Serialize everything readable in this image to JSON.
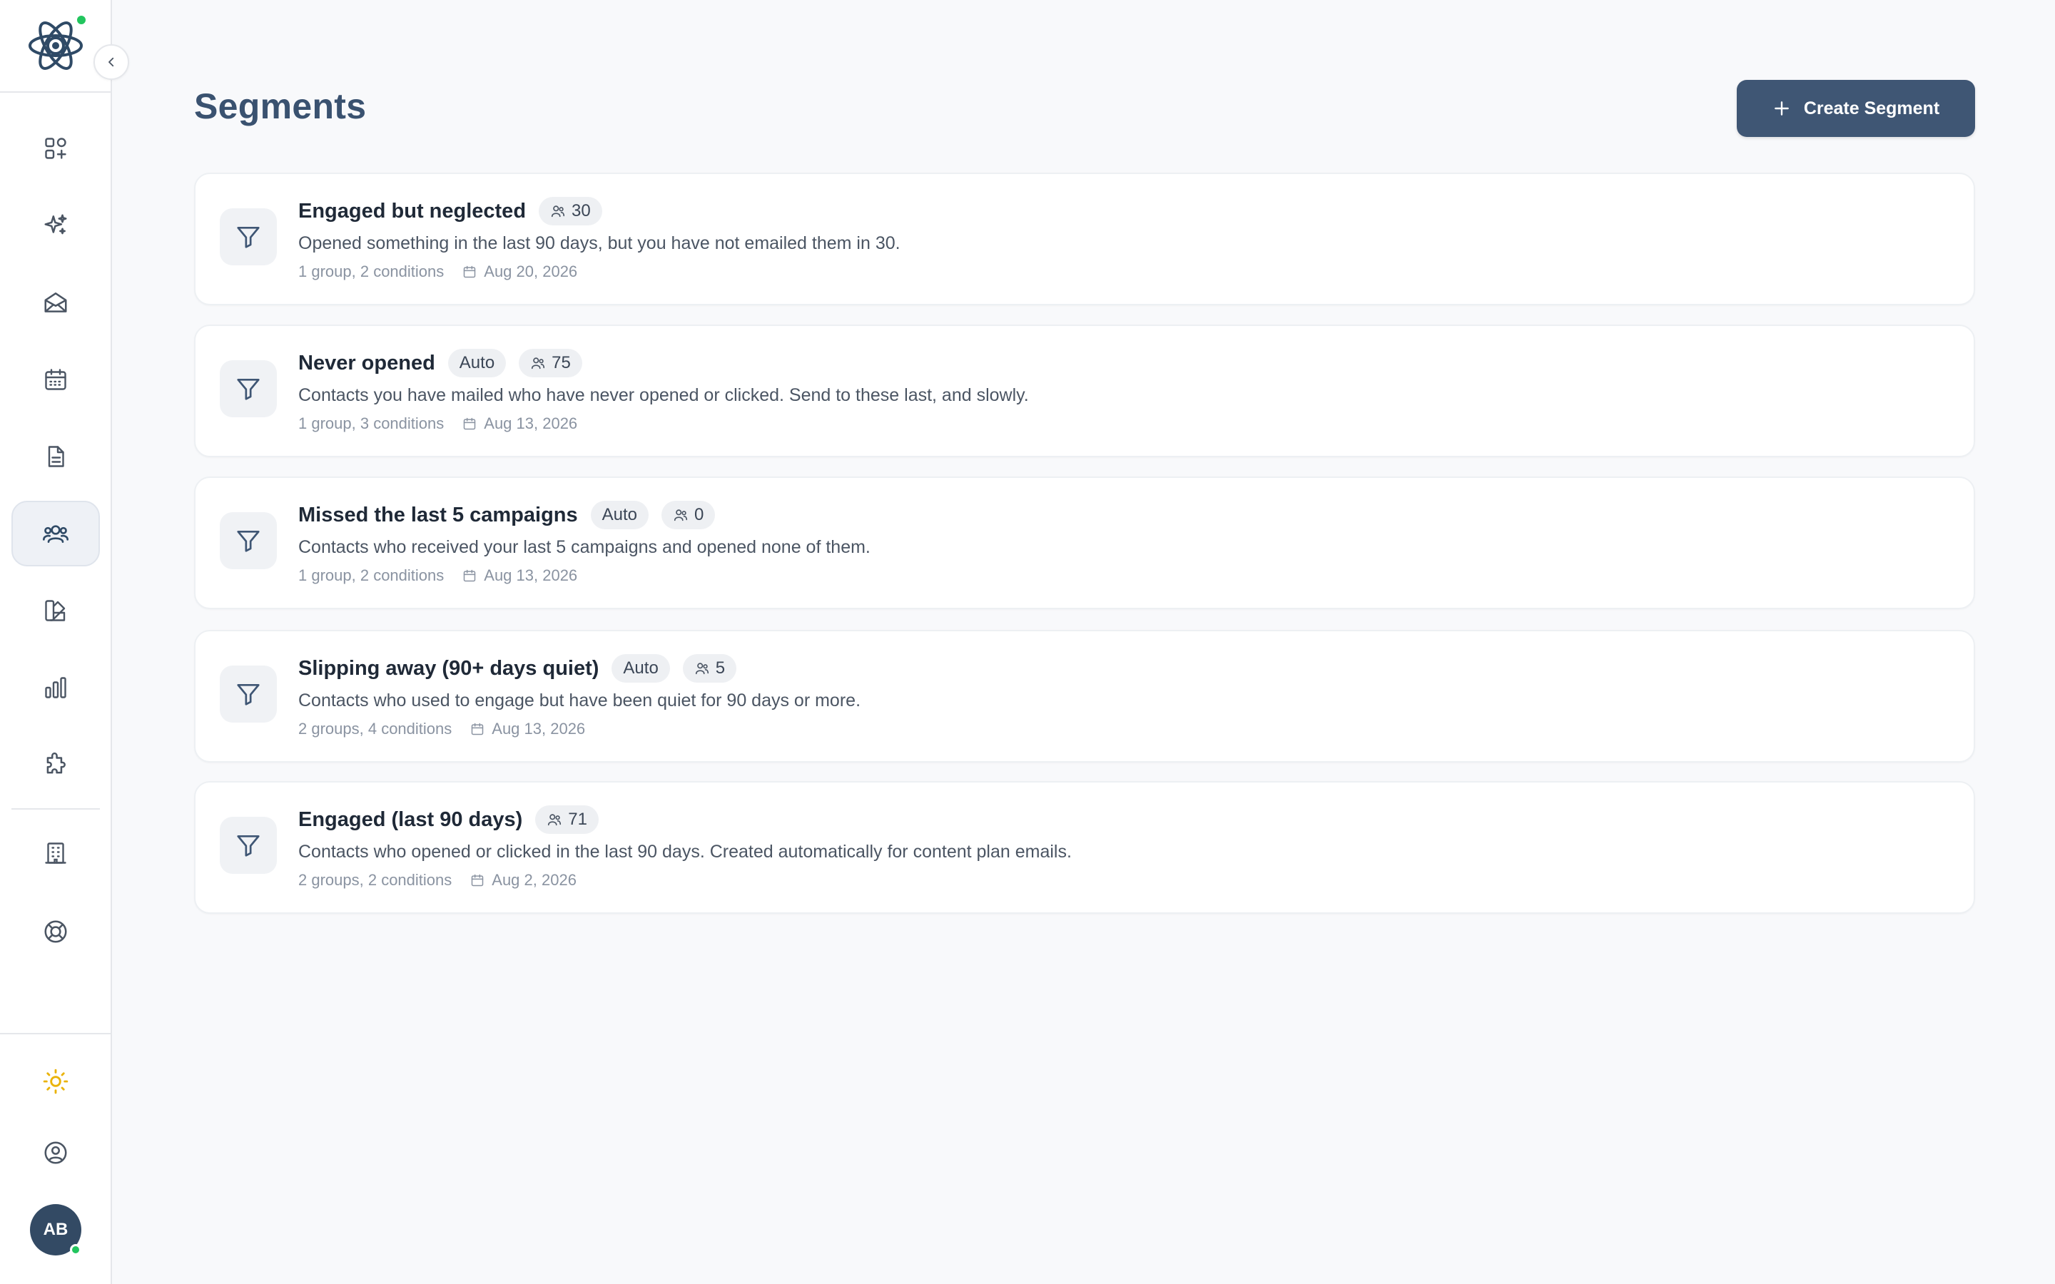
{
  "sidebar": {
    "nav": [
      {
        "icon": "apps-grid-plus-icon",
        "label": ""
      },
      {
        "icon": "sparkles-icon",
        "label": ""
      },
      {
        "icon": "envelope-open-icon",
        "label": ""
      },
      {
        "icon": "calendar-icon",
        "label": ""
      },
      {
        "icon": "document-icon",
        "label": ""
      },
      {
        "icon": "users-icon",
        "label": "",
        "active": true
      },
      {
        "icon": "swatch-palette-icon",
        "label": ""
      },
      {
        "icon": "bar-chart-icon",
        "label": ""
      },
      {
        "icon": "puzzle-icon",
        "label": ""
      },
      {
        "icon": "building-icon",
        "label": ""
      },
      {
        "icon": "life-buoy-icon",
        "label": ""
      }
    ],
    "theme_icon": "sun-icon",
    "account_icon": "user-circle-icon",
    "avatar_initials": "AB"
  },
  "header": {
    "title": "Segments",
    "create_label": "Create Segment"
  },
  "segments": [
    {
      "name": "Engaged but neglected",
      "auto": "",
      "count": "30",
      "description": "Opened something in the last 90 days, but you have not emailed them in 30.",
      "meta": "1 group, 2 conditions",
      "date": "Aug 20, 2026"
    },
    {
      "name": "Never opened",
      "auto": "Auto",
      "count": "75",
      "description": "Contacts you have mailed who have never opened or clicked. Send to these last, and slowly.",
      "meta": "1 group, 3 conditions",
      "date": "Aug 13, 2026"
    },
    {
      "name": "Missed the last 5 campaigns",
      "auto": "Auto",
      "count": "0",
      "description": "Contacts who received your last 5 campaigns and opened none of them.",
      "meta": "1 group, 2 conditions",
      "date": "Aug 13, 2026"
    },
    {
      "name": "Slipping away (90+ days quiet)",
      "auto": "Auto",
      "count": "5",
      "description": "Contacts who used to engage but have been quiet for 90 days or more.",
      "meta": "2 groups, 4 conditions",
      "date": "Aug 13, 2026"
    },
    {
      "name": "Engaged (last 90 days)",
      "auto": "",
      "count": "71",
      "description": "Contacts who opened or clicked in the last 90 days. Created automatically for content plan emails.",
      "meta": "2 groups, 2 conditions",
      "date": "Aug 2, 2026"
    }
  ],
  "colors": {
    "primary": "#3f5674",
    "title": "#3a5270",
    "online": "#22c55e",
    "theme_icon": "#eab308"
  }
}
